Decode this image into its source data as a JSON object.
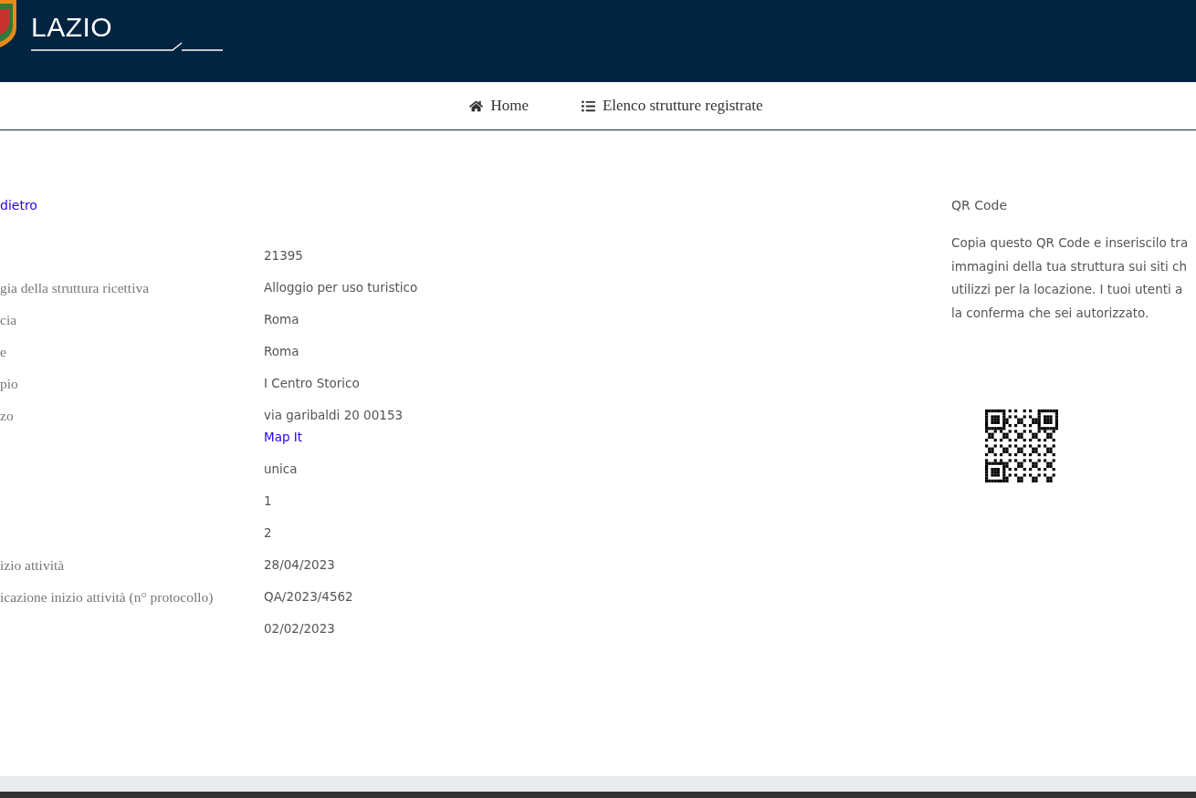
{
  "header": {
    "logo_text": "LAZIO"
  },
  "nav": [
    {
      "label": "Home"
    },
    {
      "label": "Elenco strutture registrate"
    }
  ],
  "back_link": "dietro",
  "details": [
    {
      "value": "21395"
    },
    {
      "label": "gia della struttura ricettiva",
      "value": "Alloggio per uso turistico"
    },
    {
      "label": "cia",
      "value": "Roma"
    },
    {
      "label": "e",
      "value": "Roma"
    },
    {
      "label": "pio",
      "value": "I Centro Storico"
    },
    {
      "label": "zo",
      "value": "via garibaldi 20 00153",
      "link": "Map It"
    },
    {
      "value": "unica"
    },
    {
      "value": "1"
    },
    {
      "value": "2"
    },
    {
      "label": "izio attività",
      "value": "28/04/2023"
    },
    {
      "label": "icazione inizio attività (n° protocollo)",
      "value": "QA/2023/4562"
    },
    {
      "value": "02/02/2023"
    }
  ],
  "qr_panel": {
    "title": "QR Code",
    "text_lines": [
      "Copia questo QR Code e inseriscilo tra",
      "immagini della tua struttura sui siti ch",
      "utilizzi per la locazione. I tuoi utenti a",
      "la conferma che sei autorizzato."
    ]
  }
}
